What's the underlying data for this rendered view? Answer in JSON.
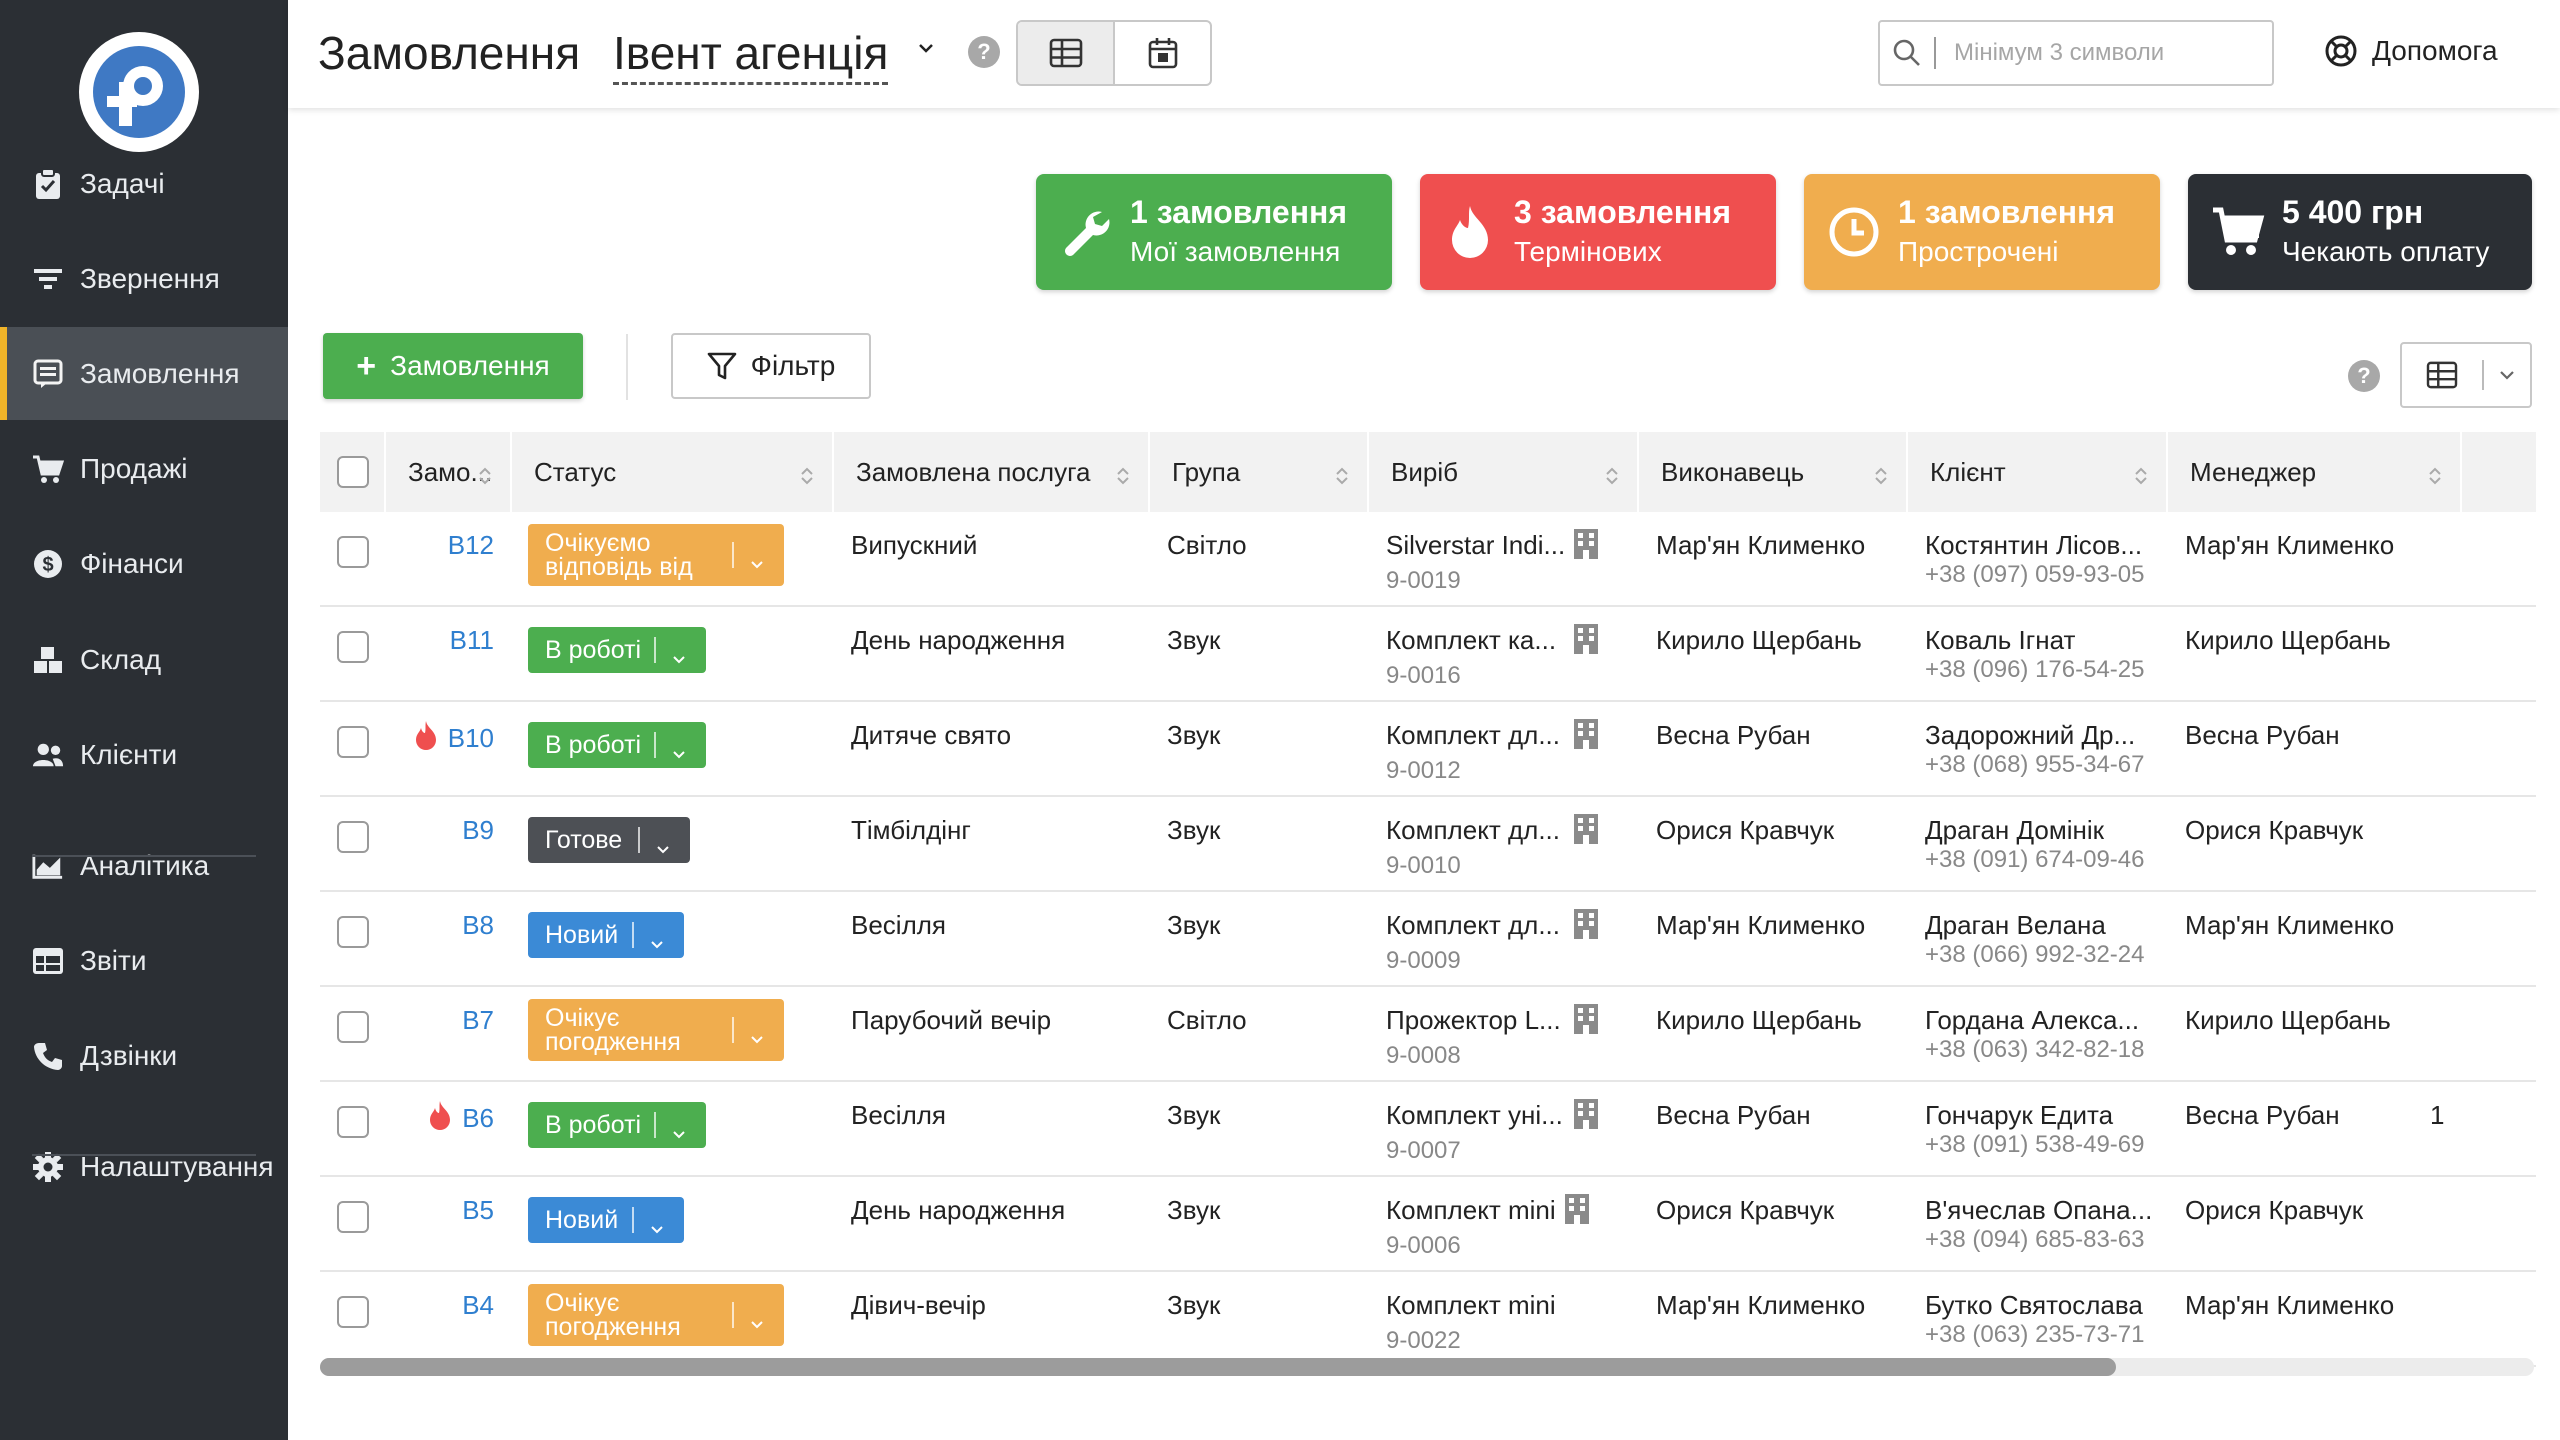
{
  "sidebar": {
    "items": [
      {
        "label": "Задачі",
        "icon": "clipboard-check-icon"
      },
      {
        "label": "Звернення",
        "icon": "filter-lines-icon"
      },
      {
        "label": "Замовлення",
        "icon": "order-list-icon"
      },
      {
        "label": "Продажі",
        "icon": "cart-icon"
      },
      {
        "label": "Фінанси",
        "icon": "dollar-circle-icon"
      },
      {
        "label": "Склад",
        "icon": "boxes-icon"
      },
      {
        "label": "Клієнти",
        "icon": "users-icon"
      },
      {
        "label": "Аналітика",
        "icon": "area-chart-icon"
      },
      {
        "label": "Звіти",
        "icon": "table-report-icon"
      },
      {
        "label": "Дзвінки",
        "icon": "phone-icon"
      },
      {
        "label": "Налаштування",
        "icon": "gear-icon"
      }
    ],
    "active_index": 2
  },
  "header": {
    "title": "Замовлення",
    "agency": "Івент агенція",
    "help_badge": "?",
    "search_placeholder": "Мінімум 3 символи",
    "help_label": "Допомога"
  },
  "cards": [
    {
      "title": "1 замовлення",
      "subtitle": "Мої замовлення",
      "color": "#4cae4f",
      "icon": "wrench-icon"
    },
    {
      "title": "3 замовлення",
      "subtitle": "Термінових",
      "color": "#ef4f4f",
      "icon": "fire-icon"
    },
    {
      "title": "1 замовлення",
      "subtitle": "Прострочені",
      "color": "#f0ad4e",
      "icon": "clock-icon"
    },
    {
      "title": "5 400 грн",
      "subtitle": "Чекають оплату",
      "color": "#2b2f34",
      "icon": "cart-icon"
    }
  ],
  "toolbar": {
    "add_label": "Замовлення",
    "add_plus": "+",
    "filter_label": "Фільтр",
    "help_badge": "?"
  },
  "table": {
    "columns": [
      "Замо...",
      "Статус",
      "Замовлена послуга",
      "Група",
      "Виріб",
      "Виконавець",
      "Клієнт",
      "Менеджер"
    ],
    "rows": [
      {
        "num": "B12",
        "urgent": false,
        "status": "Очікуємо відповідь від",
        "status_color": "#f0ad4e",
        "service": "Випускний",
        "group": "Світло",
        "product": "Silverstar Indi...",
        "product_code": "9-0019",
        "building": true,
        "executor": "Мар'ян Клименко",
        "client": "Костянтин Лісов...",
        "phone": "+38 (097) 059-93-05",
        "manager": "Мар'ян Клименко",
        "extra": ""
      },
      {
        "num": "B11",
        "urgent": false,
        "status": "В роботі",
        "status_color": "#4cae4f",
        "service": "День народження",
        "group": "Звук",
        "product": "Комплект ка...",
        "product_code": "9-0016",
        "building": true,
        "executor": "Кирило Щербань",
        "client": "Коваль Ігнат",
        "phone": "+38 (096) 176-54-25",
        "manager": "Кирило Щербань",
        "extra": ""
      },
      {
        "num": "B10",
        "urgent": true,
        "status": "В роботі",
        "status_color": "#4cae4f",
        "service": "Дитяче свято",
        "group": "Звук",
        "product": "Комплект дл...",
        "product_code": "9-0012",
        "building": true,
        "executor": "Весна Рубан",
        "client": "Задорожний Др...",
        "phone": "+38 (068) 955-34-67",
        "manager": "Весна Рубан",
        "extra": ""
      },
      {
        "num": "B9",
        "urgent": false,
        "status": "Готове",
        "status_color": "#4d5055",
        "service": "Тімбілдінг",
        "group": "Звук",
        "product": "Комплект дл...",
        "product_code": "9-0010",
        "building": true,
        "executor": "Орися Кравчук",
        "client": "Драган Домінік",
        "phone": "+38 (091) 674-09-46",
        "manager": "Орися Кравчук",
        "extra": ""
      },
      {
        "num": "B8",
        "urgent": false,
        "status": "Новий",
        "status_color": "#3b8ad6",
        "service": "Весілля",
        "group": "Звук",
        "product": "Комплект дл...",
        "product_code": "9-0009",
        "building": true,
        "executor": "Мар'ян Клименко",
        "client": "Драган Велана",
        "phone": "+38 (066) 992-32-24",
        "manager": "Мар'ян Клименко",
        "extra": ""
      },
      {
        "num": "B7",
        "urgent": false,
        "status": "Очікує погодження",
        "status_color": "#f0ad4e",
        "service": "Парубочий вечір",
        "group": "Світло",
        "product": "Прожектор L...",
        "product_code": "9-0008",
        "building": true,
        "executor": "Кирило Щербань",
        "client": "Гордана Алекса...",
        "phone": "+38 (063) 342-82-18",
        "manager": "Кирило Щербань",
        "extra": ""
      },
      {
        "num": "B6",
        "urgent": true,
        "status": "В роботі",
        "status_color": "#4cae4f",
        "service": "Весілля",
        "group": "Звук",
        "product": "Комплект уні...",
        "product_code": "9-0007",
        "building": true,
        "executor": "Весна Рубан",
        "client": "Гончарук Едита",
        "phone": "+38 (091) 538-49-69",
        "manager": "Весна Рубан",
        "extra": "1"
      },
      {
        "num": "B5",
        "urgent": false,
        "status": "Новий",
        "status_color": "#3b8ad6",
        "service": "День народження",
        "group": "Звук",
        "product": "Комплект mini",
        "product_code": "9-0006",
        "building": true,
        "executor": "Орися Кравчук",
        "client": "В'ячеслав Опана...",
        "phone": "+38 (094) 685-83-63",
        "manager": "Орися Кравчук",
        "extra": ""
      },
      {
        "num": "B4",
        "urgent": false,
        "status": "Очікує погодження",
        "status_color": "#f0ad4e",
        "service": "Дівич-вечір",
        "group": "Звук",
        "product": "Комплект mini",
        "product_code": "9-0022",
        "building": false,
        "executor": "Мар'ян Клименко",
        "client": "Бутко Святослава",
        "phone": "+38 (063) 235-73-71",
        "manager": "Мар'ян Клименко",
        "extra": ""
      }
    ]
  }
}
